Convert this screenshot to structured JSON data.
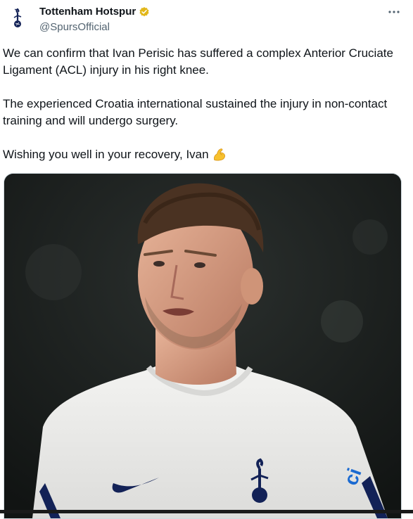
{
  "author": {
    "name": "Tottenham Hotspur",
    "handle": "@SpursOfficial",
    "verified_color": "#e2b719"
  },
  "menu": {
    "icon": "more-horizontal-icon"
  },
  "tweet": {
    "paragraph1": "We can confirm that Ivan Perisic has suffered a complex Anterior Cruciate Ligament (ACL) injury in his right knee.",
    "paragraph2": "The experienced Croatia international sustained the injury in non-contact training and will undergo surgery.",
    "paragraph3": "Wishing you well in your recovery, Ivan",
    "emoji": "flexed-biceps-emoji"
  },
  "media": {
    "subject": "player-portrait",
    "shirt_sponsor_text": "ci"
  },
  "colors": {
    "text": "#0f1419",
    "secondary": "#536471",
    "shirt": "#f1f1ef",
    "navy": "#132257"
  }
}
